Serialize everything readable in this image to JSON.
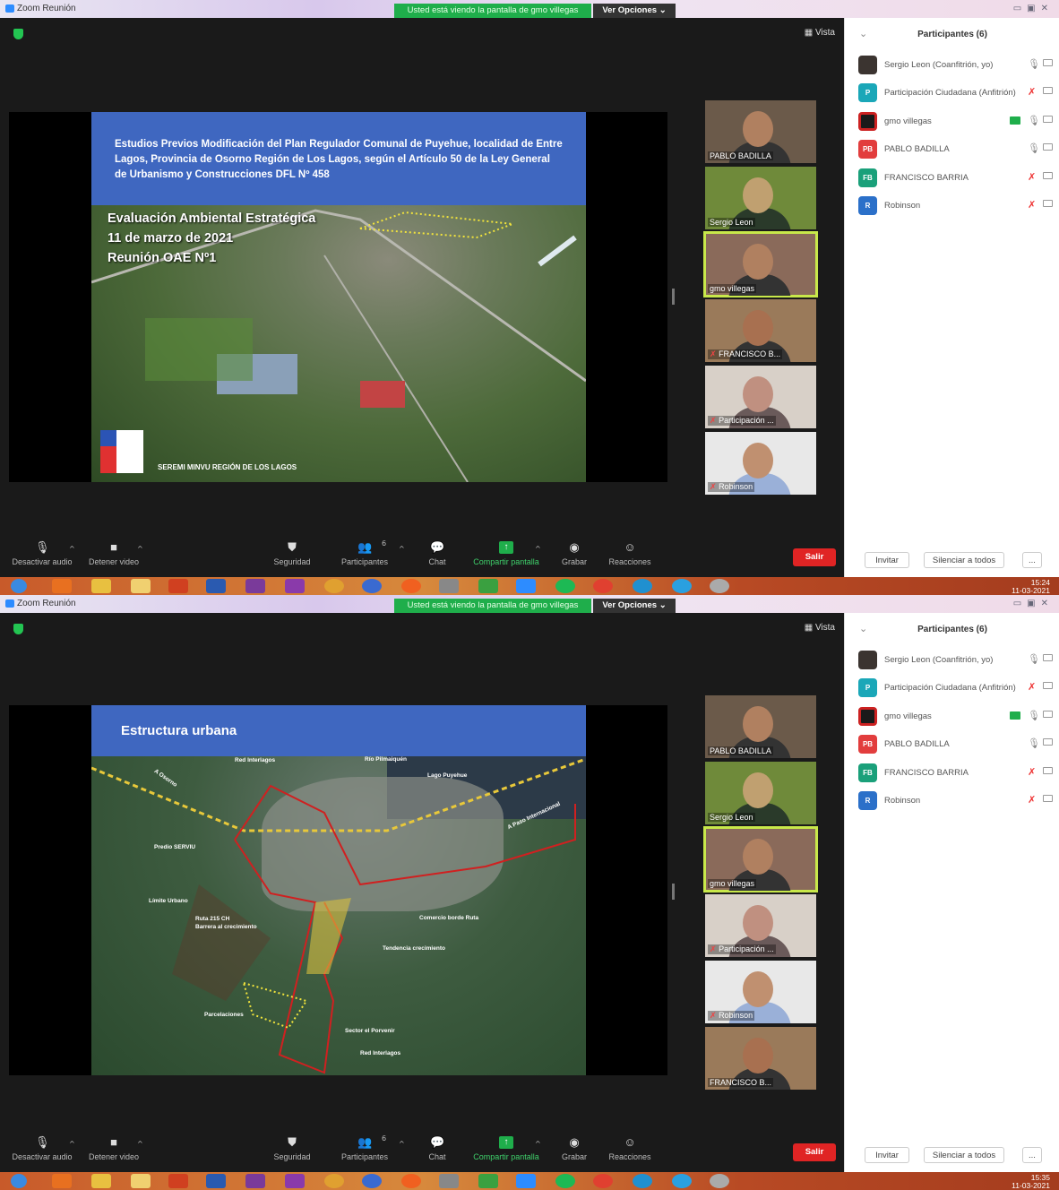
{
  "window": {
    "title": "Zoom Reunión",
    "share_banner": "Usted está viendo la pantalla de gmo villegas",
    "view_options": "Ver Opciones",
    "view_button": "Vista"
  },
  "toolbar": {
    "mute": "Desactivar audio",
    "stop_video": "Detener video",
    "security": "Seguridad",
    "participants": "Participantes",
    "participants_count": "6",
    "chat": "Chat",
    "share": "Compartir pantalla",
    "record": "Grabar",
    "reactions": "Reacciones",
    "leave": "Salir"
  },
  "panel": {
    "title": "Participantes (6)",
    "invite": "Invitar",
    "mute_all": "Silenciar a todos",
    "more": "..."
  },
  "participants": [
    {
      "name": "Sergio Leon (Coanfitrión, yo)",
      "initials": "",
      "color": "#3b3430",
      "muted": false,
      "sharing": false
    },
    {
      "name": "Participación Ciudadana (Anfitrión)",
      "initials": "P",
      "color": "#1aa7b8",
      "muted": true,
      "sharing": false
    },
    {
      "name": "gmo villegas",
      "initials": "",
      "color": "#1a1a1a",
      "muted": false,
      "sharing": true
    },
    {
      "name": "PABLO BADILLA",
      "initials": "PB",
      "color": "#e23d3d",
      "muted": false,
      "sharing": false
    },
    {
      "name": "FRANCISCO BARRIA",
      "initials": "FB",
      "color": "#1aa07a",
      "muted": true,
      "sharing": false
    },
    {
      "name": "Robinson",
      "initials": "R",
      "color": "#2b70c9",
      "muted": true,
      "sharing": false
    }
  ],
  "screen1": {
    "slide_heading": "Estudios Previos Modificación del Plan Regulador Comunal de Puyehue, localidad de Entre Lagos, Provincia de Osorno Región de Los Lagos, según el Artículo 50 de la Ley General de Urbanismo y Construcciones DFL Nº 458",
    "slide_sub1": "Evaluación Ambiental Estratégica",
    "slide_sub2": "11 de marzo de 2021",
    "slide_sub3": "Reunión OAE Nº1",
    "slide_footer": "SEREMI MINVU REGIÓN DE LOS LAGOS",
    "thumbs": [
      "PABLO BADILLA",
      "Sergio Leon",
      "gmo villegas",
      "FRANCISCO B...",
      "Participación ...",
      "Robinson"
    ],
    "clock_time": "15:24",
    "clock_date": "11-03-2021"
  },
  "screen2": {
    "slide_heading": "Estructura urbana",
    "map_labels": [
      "Red Interlagos",
      "Río Pilmaiquén",
      "Lago Puyehue",
      "A Osorno",
      "Predio SERVIU",
      "A Paso Internacional",
      "Límite Urbano",
      "Ruta 215 CH",
      "Barrera al crecimiento",
      "Comercio borde Ruta",
      "Tendencia crecimiento",
      "Parcelaciones",
      "Sector el Porvenir",
      "Red Interlagos"
    ],
    "thumbs": [
      "PABLO BADILLA",
      "Sergio Leon",
      "gmo villegas",
      "Participación ...",
      "Robinson",
      "FRANCISCO B..."
    ],
    "clock_time": "15:35",
    "clock_date": "11-03-2021"
  }
}
